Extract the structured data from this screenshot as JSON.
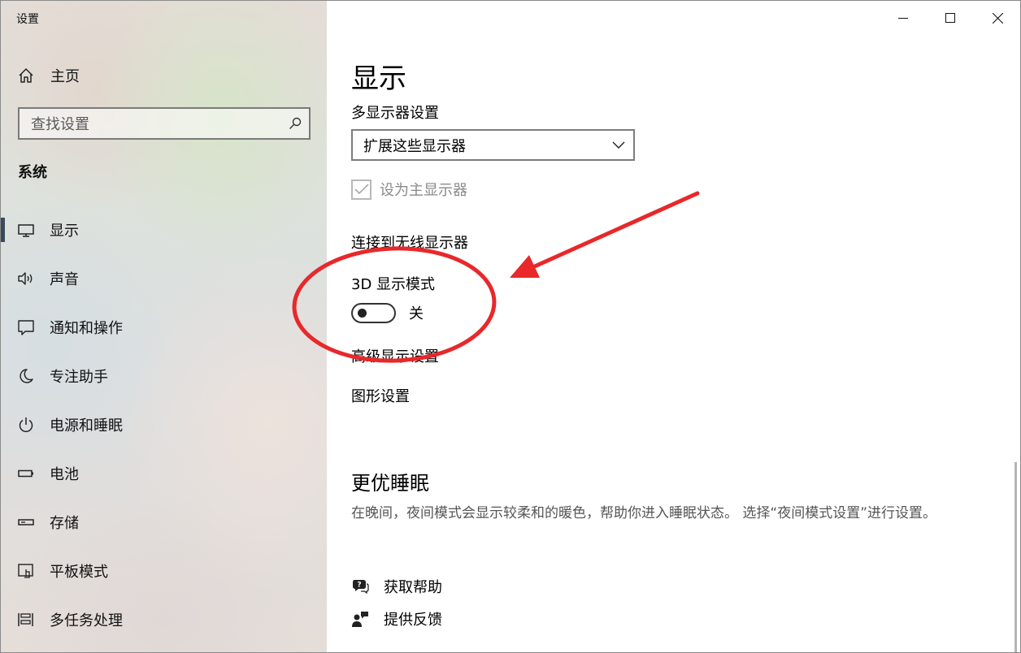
{
  "window": {
    "title": "设置",
    "controls": {
      "minimize": "minimize-icon",
      "maximize": "maximize-icon",
      "close": "close-icon"
    }
  },
  "sidebar": {
    "home_label": "主页",
    "search_placeholder": "查找设置",
    "section_title": "系统",
    "items": [
      {
        "label": "显示",
        "icon": "monitor-icon",
        "active": true
      },
      {
        "label": "声音",
        "icon": "speaker-icon"
      },
      {
        "label": "通知和操作",
        "icon": "notification-icon"
      },
      {
        "label": "专注助手",
        "icon": "moon-icon"
      },
      {
        "label": "电源和睡眠",
        "icon": "power-icon"
      },
      {
        "label": "电池",
        "icon": "battery-icon"
      },
      {
        "label": "存储",
        "icon": "storage-icon"
      },
      {
        "label": "平板模式",
        "icon": "tablet-icon"
      },
      {
        "label": "多任务处理",
        "icon": "multitask-icon"
      }
    ]
  },
  "main": {
    "title": "显示",
    "multi_display_label": "多显示器设置",
    "multi_display_value": "扩展这些显示器",
    "primary_display_label": "设为主显示器",
    "primary_display_checked": true,
    "wireless_link": "连接到无线显示器",
    "mode_3d_label": "3D 显示模式",
    "mode_3d_state": "关",
    "mode_3d_on": false,
    "advanced_link": "高级显示设置",
    "graphics_link": "图形设置",
    "sleep_title": "更优睡眠",
    "sleep_desc": "在晚间，夜间模式会显示较柔和的暖色，帮助你进入睡眠状态。 选择“夜间模式设置”进行设置。",
    "help_label": "获取帮助",
    "feedback_label": "提供反馈"
  },
  "colors": {
    "annotation_red": "#e8282b",
    "active_indicator": "#3a4a5a"
  }
}
